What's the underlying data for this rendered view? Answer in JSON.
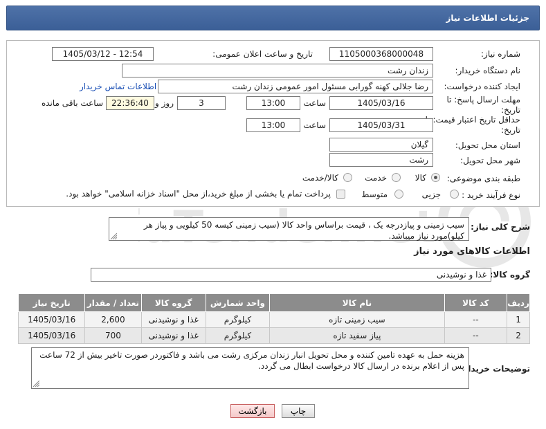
{
  "header": {
    "title": "جزئیات اطلاعات نیاز"
  },
  "form": {
    "need_number_label": "شماره نیاز:",
    "need_number": "1105000368000048",
    "announce_label": "تاریخ و ساعت اعلان عمومی:",
    "announce_value": "1405/03/12 - 12:54",
    "buyer_org_label": "نام دستگاه خریدار:",
    "buyer_org": "زندان رشت",
    "requester_label": "ایجاد کننده درخواست:",
    "requester": "رضا جلالی کهنه گورابی مسئول امور عمومی زندان رشت",
    "contact_link": "اطلاعات تماس خریدار",
    "reply_deadline_label": "مهلت ارسال پاسخ: تا تاریخ:",
    "reply_date": "1405/03/16",
    "time_label": "ساعت",
    "reply_time": "13:00",
    "days_value": "3",
    "days_label": "روز و",
    "remaining_value": "22:36:40",
    "remaining_label": "ساعت باقی مانده",
    "price_validity_label": "حداقل تاریخ اعتبار قیمت: تا تاریخ:",
    "validity_date": "1405/03/31",
    "validity_time": "13:00",
    "province_label": "استان محل تحویل:",
    "province": "گیلان",
    "city_label": "شهر محل تحویل:",
    "city": "رشت",
    "category_label": "طبقه بندی موضوعی:",
    "category_options": [
      "کالا",
      "خدمت",
      "کالا/خدمت"
    ],
    "category_selected": "کالا",
    "process_label": "نوع فرآیند خرید :",
    "process_options": [
      "جزیی",
      "متوسط"
    ],
    "treasury_note": "پرداخت تمام یا بخشی از مبلغ خرید،از محل \"اسناد خزانه اسلامی\" خواهد بود."
  },
  "summary": {
    "label": "شرح کلی نیاز:",
    "text": "سیب زمینی و پیازدرجه یک ، قیمت براساس واحد کالا (سیب زمینی کیسه 50 کیلویی و پیاز هر کیلو)مورد نیاز میباشد."
  },
  "goods_section": {
    "title": "اطلاعات کالاهای مورد نیاز",
    "group_label": "گروه کالا:",
    "group_value": "غذا و نوشیدنی"
  },
  "table": {
    "headers": [
      "ردیف",
      "کد کالا",
      "نام کالا",
      "واحد شمارش",
      "گروه کالا",
      "تعداد / مقدار",
      "تاریخ نیاز"
    ],
    "rows": [
      [
        "1",
        "--",
        "سیب زمینی تازه",
        "کیلوگرم",
        "غذا و نوشیدنی",
        "2,600",
        "1405/03/16"
      ],
      [
        "2",
        "--",
        "پیاز سفید تازه",
        "کیلوگرم",
        "غذا و نوشیدنی",
        "700",
        "1405/03/16"
      ]
    ]
  },
  "buyer_notes": {
    "label": "توضیحات خریدار:",
    "text": "هزینه حمل به عهده تامین کننده و محل تحویل انبار زندان مرکزی رشت می باشد و فاکتوردر صورت تاخیر بیش از 72 ساعت پس از اعلام برنده در ارسال کالا درخواست ابطال می گردد."
  },
  "buttons": {
    "print": "چاپ",
    "back": "بازگشت"
  },
  "watermark": {
    "text": "AriaTender.net"
  }
}
